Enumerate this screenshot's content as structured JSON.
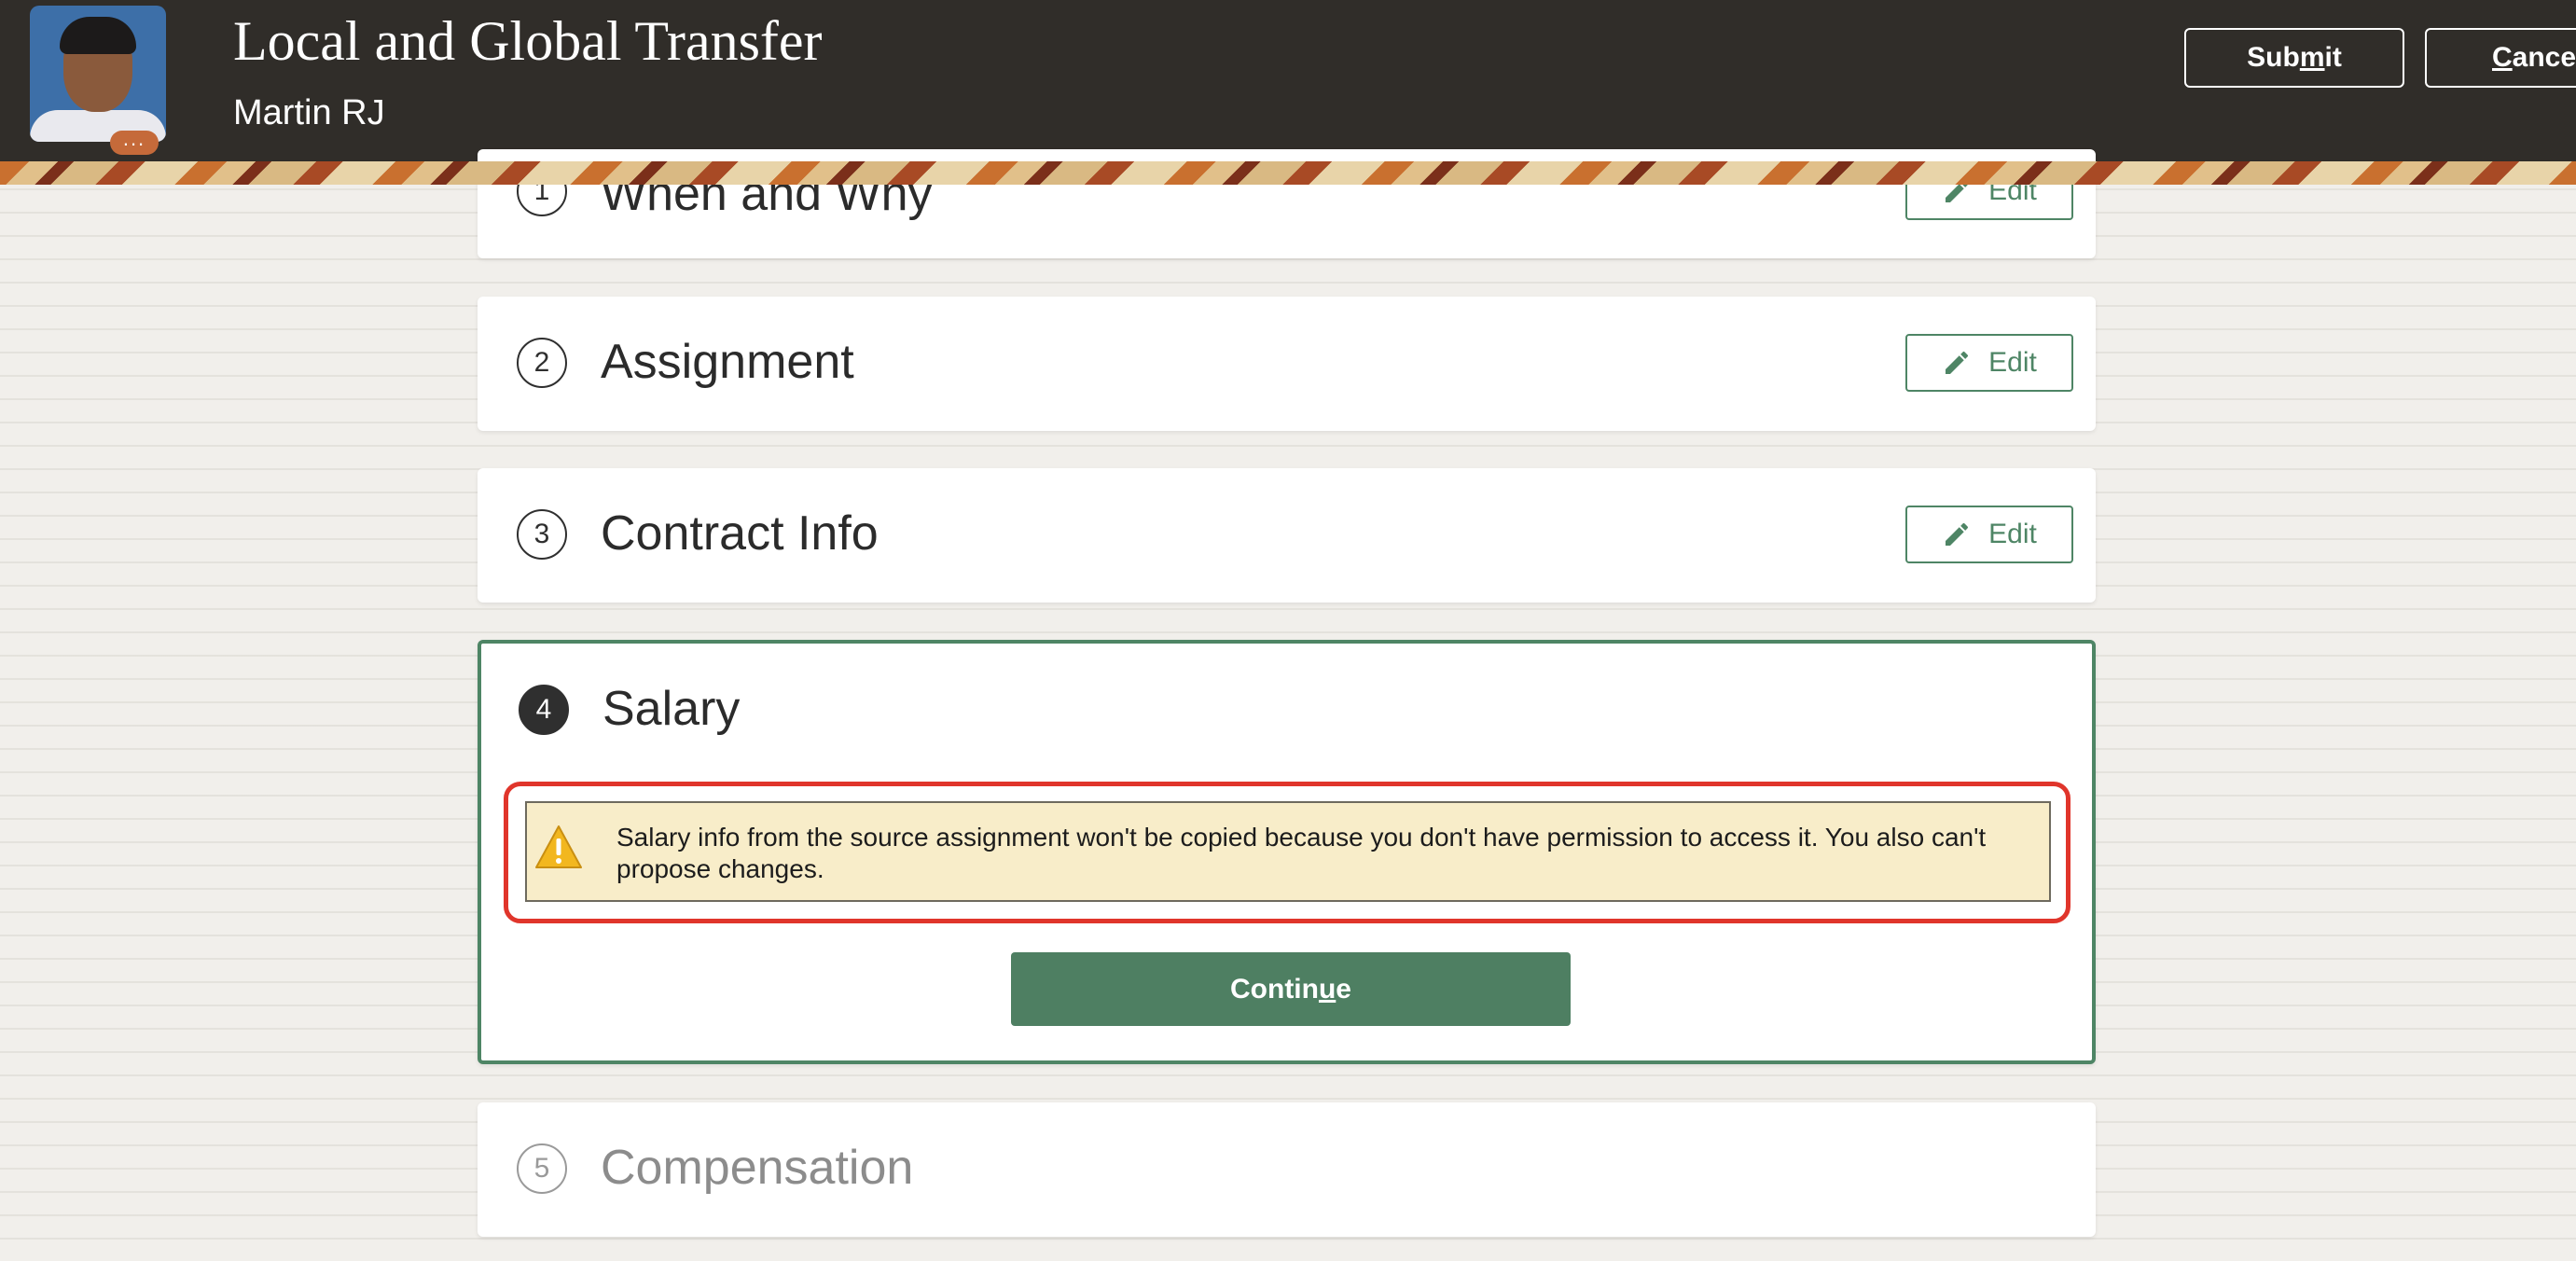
{
  "header": {
    "title": "Local and Global Transfer",
    "subtitle": "Martin RJ",
    "avatar_more": "...",
    "submit_pre": "Sub",
    "submit_key": "m",
    "submit_post": "it",
    "cancel_pre": "",
    "cancel_key": "C",
    "cancel_post": "ancel"
  },
  "steps": [
    {
      "number": "1",
      "title": "When and Why",
      "edit_label": "Edit"
    },
    {
      "number": "2",
      "title": "Assignment",
      "edit_label": "Edit"
    },
    {
      "number": "3",
      "title": "Contract Info",
      "edit_label": "Edit"
    },
    {
      "number": "4",
      "title": "Salary"
    },
    {
      "number": "5",
      "title": "Compensation"
    }
  ],
  "salary": {
    "warning": "Salary info from the source assignment won't be copied because you don't have permission to access it. You also can't propose changes.",
    "continue_pre": "Contin",
    "continue_key": "u",
    "continue_post": "e"
  },
  "colors": {
    "accent_green": "#4e7f62",
    "header_bg": "#302d29",
    "warning_bg": "#f8edc9",
    "highlight_red": "#e0352b"
  },
  "icons": {
    "edit": "pencil-icon",
    "warning": "warning-triangle-icon",
    "avatar_more": "ellipsis-icon"
  }
}
